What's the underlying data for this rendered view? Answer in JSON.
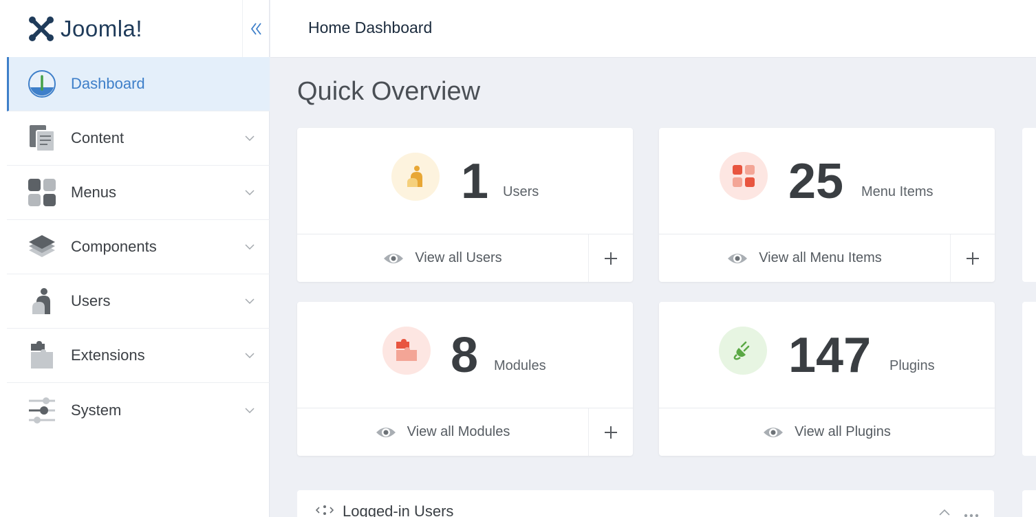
{
  "brand": {
    "name": "Joomla!"
  },
  "header": {
    "title": "Home Dashboard"
  },
  "sidebar": {
    "items": [
      {
        "label": "Dashboard",
        "icon": "dashboard-icon",
        "active": true
      },
      {
        "label": "Content",
        "icon": "content-icon",
        "active": false
      },
      {
        "label": "Menus",
        "icon": "menus-icon",
        "active": false
      },
      {
        "label": "Components",
        "icon": "components-icon",
        "active": false
      },
      {
        "label": "Users",
        "icon": "users-icon",
        "active": false
      },
      {
        "label": "Extensions",
        "icon": "extensions-icon",
        "active": false
      },
      {
        "label": "System",
        "icon": "system-icon",
        "active": false
      }
    ]
  },
  "main": {
    "title": "Quick Overview",
    "cards": [
      {
        "count": "1",
        "label": "Users",
        "view": "View all Users",
        "icon": "users-icon"
      },
      {
        "count": "25",
        "label": "Menu Items",
        "view": "View all Menu Items",
        "icon": "menu-items-icon"
      },
      {
        "count": "8",
        "label": "Modules",
        "view": "View all Modules",
        "icon": "modules-icon"
      },
      {
        "count": "147",
        "label": "Plugins",
        "view": "View all Plugins",
        "icon": "plugins-icon"
      }
    ],
    "logged_in": {
      "title": "Logged-in Users"
    }
  },
  "colors": {
    "accent": "#3e7fc9",
    "brand_dark": "#1f3b5a",
    "background": "#eef0f5"
  }
}
